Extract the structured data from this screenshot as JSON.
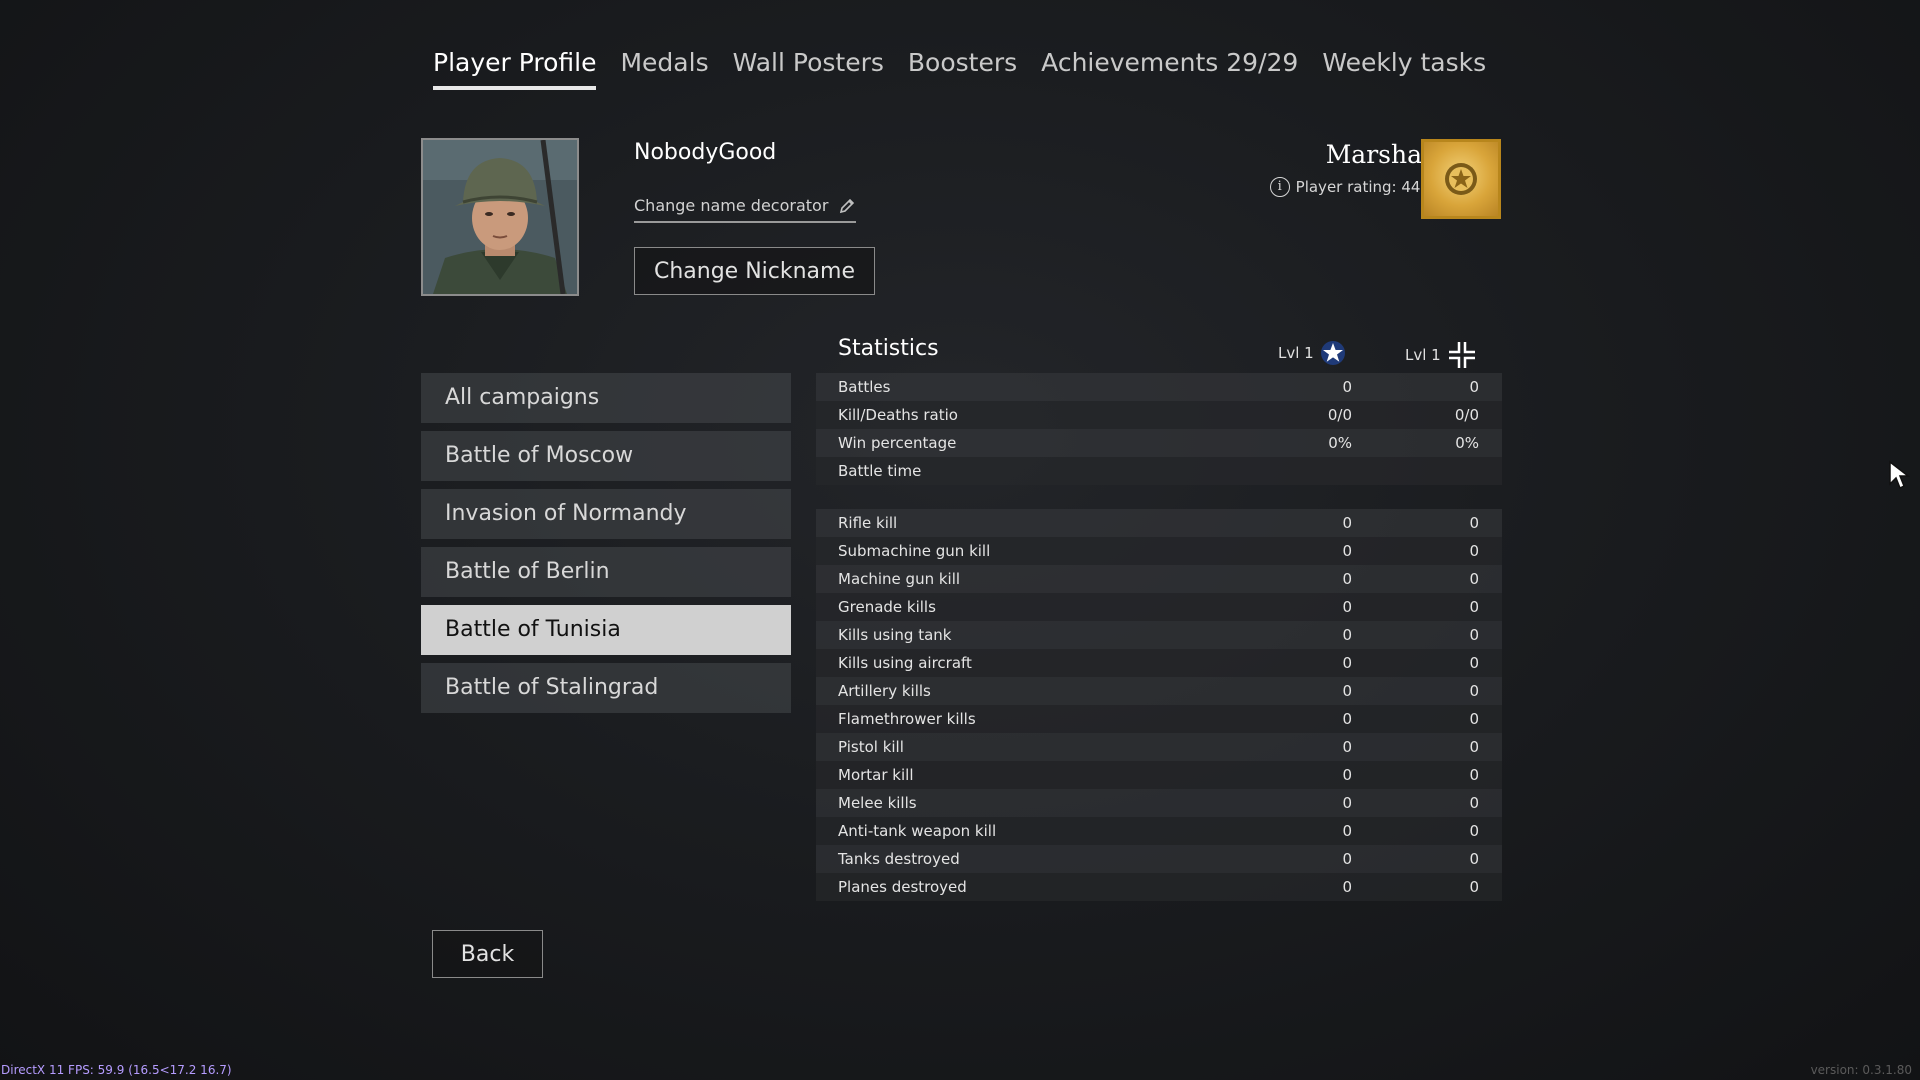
{
  "tabs": [
    {
      "label": "Player Profile",
      "active": true
    },
    {
      "label": "Medals",
      "active": false
    },
    {
      "label": "Wall Posters",
      "active": false
    },
    {
      "label": "Boosters",
      "active": false
    },
    {
      "label": "Achievements 29/29",
      "active": false
    },
    {
      "label": "Weekly tasks",
      "active": false
    }
  ],
  "profile": {
    "nickname": "NobodyGood",
    "decorator_label": "Change name decorator",
    "change_nickname_label": "Change Nickname",
    "rank": "Marshal",
    "rating_text": "Player rating: 445",
    "rank_badge_color": "#d9a53a"
  },
  "campaigns": [
    {
      "label": "All campaigns",
      "selected": false
    },
    {
      "label": "Battle of Moscow",
      "selected": false
    },
    {
      "label": "Invasion of Normandy",
      "selected": false
    },
    {
      "label": "Battle of Berlin",
      "selected": false
    },
    {
      "label": "Battle of Tunisia",
      "selected": true
    },
    {
      "label": "Battle of Stalingrad",
      "selected": false
    }
  ],
  "statistics": {
    "title": "Statistics",
    "col1_level": "Lvl 1",
    "col1_icon": "star-roundel-icon",
    "col2_level": "Lvl 1",
    "col2_icon": "cross-brackets-icon",
    "general": [
      {
        "label": "Battles",
        "v1": "0",
        "v2": "0"
      },
      {
        "label": "Kill/Deaths ratio",
        "v1": "0/0",
        "v2": "0/0"
      },
      {
        "label": "Win percentage",
        "v1": "0%",
        "v2": "0%"
      },
      {
        "label": "Battle time",
        "v1": "",
        "v2": ""
      }
    ],
    "kills": [
      {
        "label": "Rifle kill",
        "v1": "0",
        "v2": "0"
      },
      {
        "label": "Submachine gun kill",
        "v1": "0",
        "v2": "0"
      },
      {
        "label": "Machine gun kill",
        "v1": "0",
        "v2": "0"
      },
      {
        "label": "Grenade kills",
        "v1": "0",
        "v2": "0"
      },
      {
        "label": "Kills using tank",
        "v1": "0",
        "v2": "0"
      },
      {
        "label": "Kills using aircraft",
        "v1": "0",
        "v2": "0"
      },
      {
        "label": "Artillery kills",
        "v1": "0",
        "v2": "0"
      },
      {
        "label": "Flamethrower kills",
        "v1": "0",
        "v2": "0"
      },
      {
        "label": "Pistol kill",
        "v1": "0",
        "v2": "0"
      },
      {
        "label": "Mortar kill",
        "v1": "0",
        "v2": "0"
      },
      {
        "label": "Melee kills",
        "v1": "0",
        "v2": "0"
      },
      {
        "label": "Anti-tank weapon kill",
        "v1": "0",
        "v2": "0"
      },
      {
        "label": "Tanks destroyed",
        "v1": "0",
        "v2": "0"
      },
      {
        "label": "Planes destroyed",
        "v1": "0",
        "v2": "0"
      }
    ]
  },
  "back_label": "Back",
  "overlay": {
    "fps_text": "DirectX 11 FPS: 59.9 (16.5<17.2 16.7)",
    "version_text": "version: 0.3.1.80"
  }
}
